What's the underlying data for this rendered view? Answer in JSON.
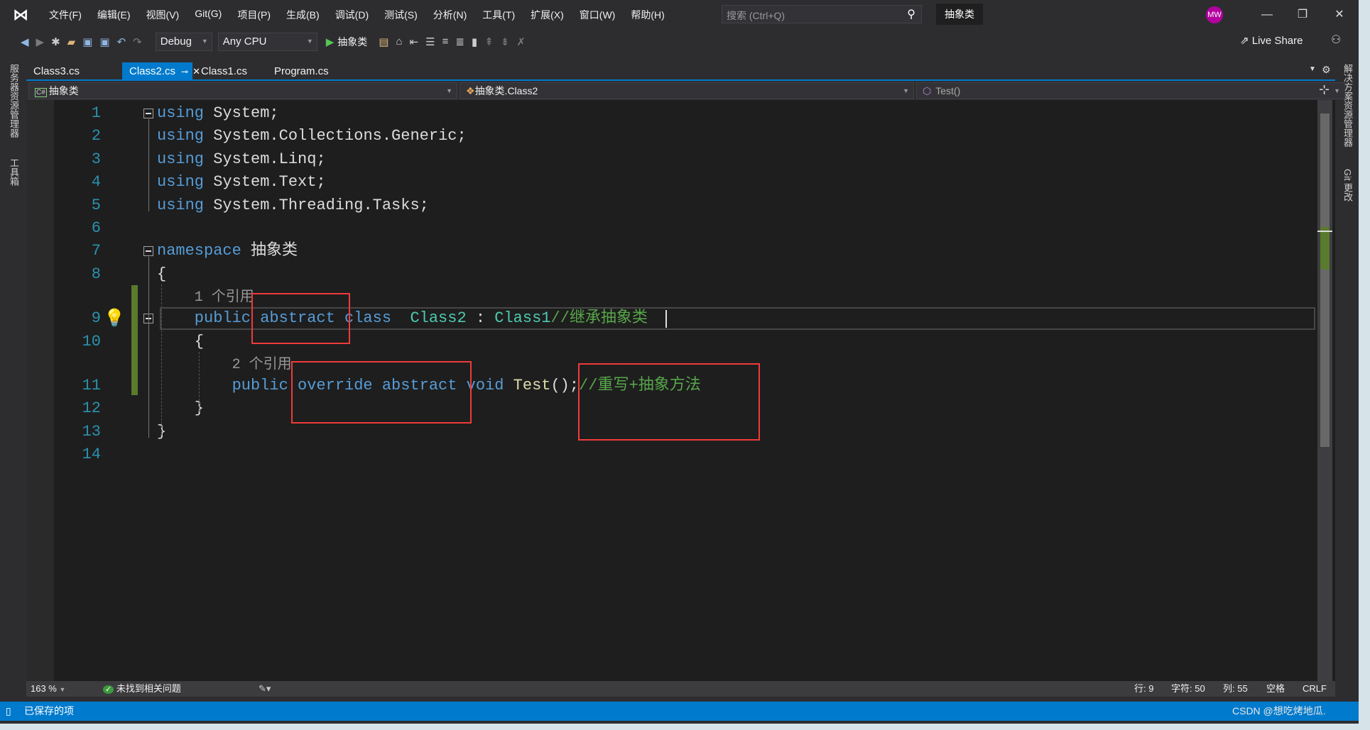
{
  "titlebar": {
    "menu": [
      "文件(F)",
      "编辑(E)",
      "视图(V)",
      "Git(G)",
      "项目(P)",
      "生成(B)",
      "调试(D)",
      "测试(S)",
      "分析(N)",
      "工具(T)",
      "扩展(X)",
      "窗口(W)",
      "帮助(H)"
    ],
    "search_placeholder": "搜索 (Ctrl+Q)",
    "solution_name": "抽象类",
    "avatar": "MW"
  },
  "toolbar": {
    "config": "Debug",
    "platform": "Any CPU",
    "start_label": "抽象类",
    "live_share": "Live Share"
  },
  "side_left": [
    "服务器资源管理器",
    "工具箱"
  ],
  "side_right": [
    "解决方案资源管理器",
    "Git 更改"
  ],
  "tabs": [
    {
      "label": "Class3.cs",
      "active": false
    },
    {
      "label": "Class2.cs",
      "active": true
    },
    {
      "label": "Class1.cs",
      "active": false
    },
    {
      "label": "Program.cs",
      "active": false
    }
  ],
  "navbar": {
    "project": "抽象类",
    "type": "抽象类.Class2",
    "member": "Test()"
  },
  "editor": {
    "lines": [
      {
        "n": "1",
        "indent": 0,
        "tokens": [
          {
            "t": "using",
            "c": "kw"
          },
          {
            "t": " System;",
            "c": "tx"
          }
        ]
      },
      {
        "n": "2",
        "indent": 0,
        "tokens": [
          {
            "t": "using",
            "c": "kw"
          },
          {
            "t": " System.Collections.Generic;",
            "c": "tx"
          }
        ]
      },
      {
        "n": "3",
        "indent": 0,
        "tokens": [
          {
            "t": "using",
            "c": "kw"
          },
          {
            "t": " System.Linq;",
            "c": "tx"
          }
        ]
      },
      {
        "n": "4",
        "indent": 0,
        "tokens": [
          {
            "t": "using",
            "c": "kw"
          },
          {
            "t": " System.Text;",
            "c": "tx"
          }
        ]
      },
      {
        "n": "5",
        "indent": 0,
        "tokens": [
          {
            "t": "using",
            "c": "kw"
          },
          {
            "t": " System.Threading.Tasks;",
            "c": "tx"
          }
        ]
      },
      {
        "n": "6",
        "indent": 0,
        "tokens": []
      },
      {
        "n": "7",
        "indent": 0,
        "tokens": [
          {
            "t": "namespace",
            "c": "kw"
          },
          {
            "t": " 抽象类",
            "c": "tx"
          }
        ]
      },
      {
        "n": "8",
        "indent": 0,
        "tokens": [
          {
            "t": "{",
            "c": "tx"
          }
        ]
      },
      {
        "n": "9",
        "indent": 4,
        "lens": "1 个引用",
        "tokens": [
          {
            "t": "public abstract class",
            "c": "kw"
          },
          {
            "t": "  ",
            "c": "tx"
          },
          {
            "t": "Class2",
            "c": "ty"
          },
          {
            "t": " : ",
            "c": "tx"
          },
          {
            "t": "Class1",
            "c": "ty"
          },
          {
            "t": "//继承抽象类",
            "c": "cm"
          }
        ]
      },
      {
        "n": "10",
        "indent": 4,
        "tokens": [
          {
            "t": "{",
            "c": "tx"
          }
        ]
      },
      {
        "n": "11",
        "indent": 8,
        "lens": "2 个引用",
        "tokens": [
          {
            "t": "public override abstract void",
            "c": "kw"
          },
          {
            "t": " ",
            "c": "tx"
          },
          {
            "t": "Test",
            "c": "fn"
          },
          {
            "t": "();",
            "c": "tx"
          },
          {
            "t": "//重写+抽象方法",
            "c": "cm"
          }
        ]
      },
      {
        "n": "12",
        "indent": 4,
        "tokens": [
          {
            "t": "}",
            "c": "tx"
          }
        ]
      },
      {
        "n": "13",
        "indent": 0,
        "tokens": [
          {
            "t": "}",
            "c": "tx"
          }
        ]
      },
      {
        "n": "14",
        "indent": 0,
        "tokens": []
      }
    ]
  },
  "editor_status": {
    "zoom": "163 %",
    "issues": "未找到相关问题",
    "line": "行: 9",
    "char": "字符: 50",
    "col": "列: 55",
    "spaces": "空格",
    "eol": "CRLF"
  },
  "app_status": {
    "message": "已保存的项",
    "watermark": "CSDN @想吃烤地瓜."
  },
  "colors": {
    "keyword": "#569cd6",
    "type": "#4ec9b0",
    "comment": "#57a64a",
    "method": "#dcdcaa",
    "line_number": "#2b91af",
    "accent": "#007acc",
    "annotation": "#f03a3a"
  }
}
